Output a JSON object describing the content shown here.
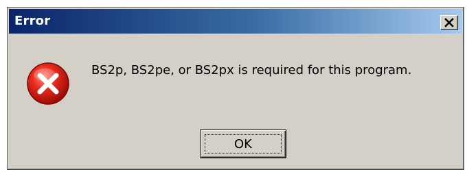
{
  "dialog": {
    "title": "Error",
    "message": "BS2p, BS2pe, or BS2px is required for this program.",
    "ok_label": "OK",
    "close_icon": "close-icon",
    "status_icon": "error-icon"
  },
  "colors": {
    "title_gradient_start": "#0a246a",
    "title_gradient_end": "#a6caf0",
    "dialog_face": "#d4d0c8",
    "error_red": "#e02020"
  }
}
